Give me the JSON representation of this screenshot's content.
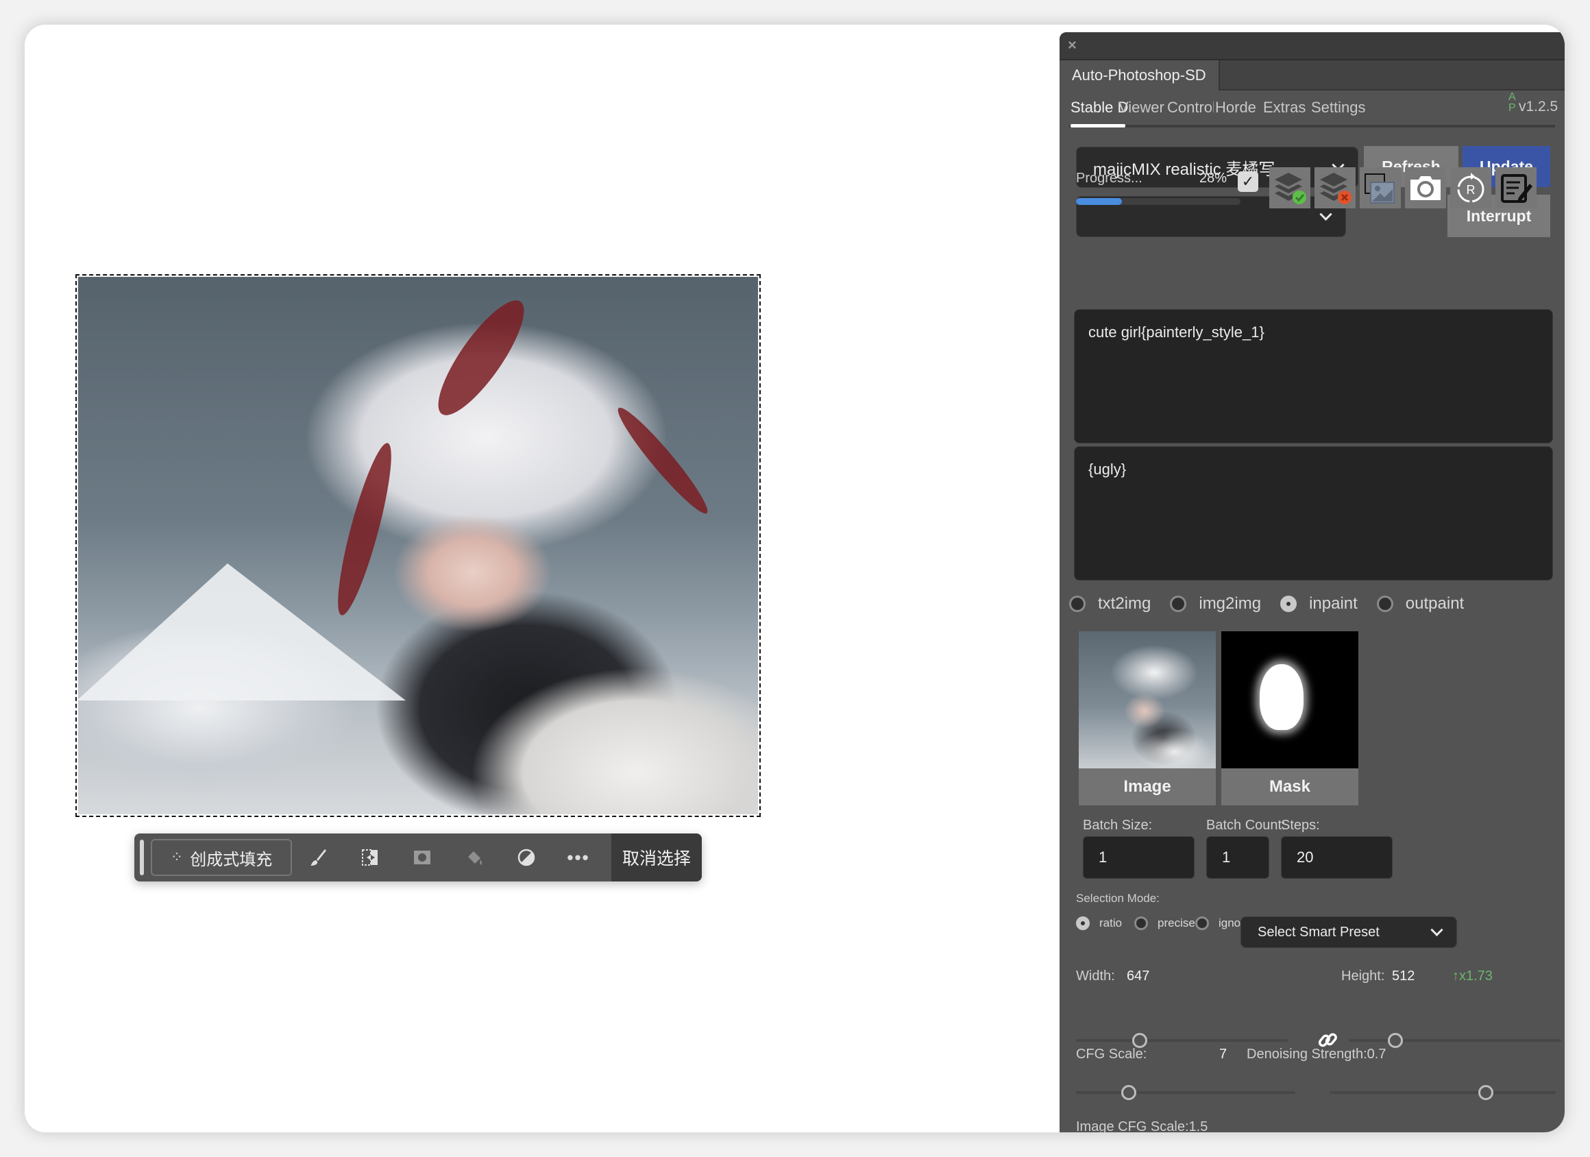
{
  "canvas": {
    "contextual_taskbar": {
      "generative_fill_label": "创成式填充",
      "deselect_label": "取消选择",
      "tools": [
        "brush-icon",
        "transform-selection-icon",
        "mask-icon",
        "fill-icon",
        "invert-icon",
        "more-icon"
      ]
    }
  },
  "panel": {
    "close_glyph": "×",
    "tab_title": "Auto-Photoshop-SD",
    "nav": {
      "items": [
        "Stable D",
        "Viewer",
        "ControlN",
        "Horde",
        "Extras",
        "Settings"
      ],
      "active_index": 0,
      "ap_badge_top": "A",
      "ap_badge_bottom": "P",
      "version": "v1.2.5"
    },
    "model_select": {
      "value": "majicMIX realistic 麦橘写…"
    },
    "secondary_select": {
      "value": ""
    },
    "buttons": {
      "refresh": "Refresh",
      "update": "Update",
      "interrupt": "Interrupt"
    },
    "progress": {
      "label": "Progress...",
      "percent_text": "28%",
      "value": 0.28
    },
    "toggle_checkbox": {
      "checked": true
    },
    "icon_buttons": [
      "layers-check-icon",
      "layers-cancel-icon",
      "image-selection-icon",
      "camera-icon",
      "reset-icon",
      "edit-notes-icon"
    ],
    "prompt": "cute girl{painterly_style_1}",
    "negative_prompt": "{ugly}",
    "modes": [
      {
        "label": "txt2img",
        "selected": false
      },
      {
        "label": "img2img",
        "selected": false
      },
      {
        "label": "inpaint",
        "selected": true
      },
      {
        "label": "outpaint",
        "selected": false
      }
    ],
    "thumbnails": {
      "image_label": "Image",
      "mask_label": "Mask"
    },
    "batch_size": {
      "label": "Batch Size:",
      "value": "1"
    },
    "batch_count": {
      "label": "Batch Count:",
      "value": "1"
    },
    "steps": {
      "label": "Steps:",
      "value": "20"
    },
    "selection_mode": {
      "label": "Selection Mode:",
      "options": [
        {
          "label": "ratio",
          "selected": true
        },
        {
          "label": "precise",
          "selected": false
        },
        {
          "label": "ignore",
          "selected": false
        }
      ],
      "preset_placeholder": "Select Smart Preset"
    },
    "width": {
      "label": "Width:",
      "value": "647"
    },
    "height": {
      "label": "Height:",
      "value": "512"
    },
    "scale_ratio": "↑x1.73",
    "cfg_scale": {
      "label": "CFG Scale:",
      "value": "7"
    },
    "denoising": {
      "label": "Denoising Strength:",
      "value": "0.7"
    },
    "image_cfg_scale": {
      "label": "Image CFG Scale:",
      "value": "1.5"
    }
  },
  "colors": {
    "panel_bg": "#535353",
    "accent_blue": "#3b55a6",
    "progress_blue": "#4a8de0",
    "ratio_green": "#6db56d"
  }
}
